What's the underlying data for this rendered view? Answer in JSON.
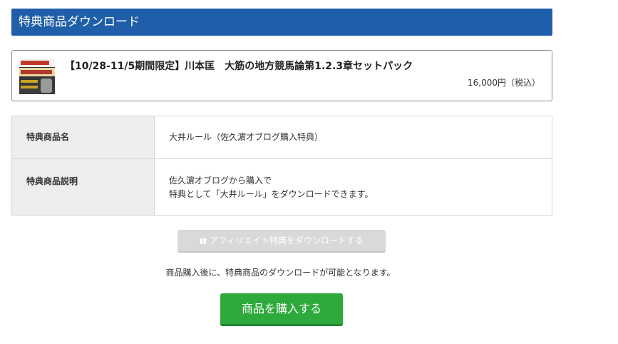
{
  "section": {
    "title": "特典商品ダウンロード"
  },
  "product": {
    "thumbnail_icon": "product-thumbnail",
    "title": "【10/28-11/5期間限定】川本匡　大筋の地方競馬論第1.2.3章セットパック",
    "price": "16,000円（税込）"
  },
  "details": {
    "rows": [
      {
        "label": "特典商品名",
        "value_lines": [
          "大井ルール（佐久濵才ブログ購入特典）"
        ]
      },
      {
        "label": "特典商品説明",
        "value_lines": [
          "佐久濵才ブログから購入で",
          "特典として「大井ルール」をダウンロードできます。"
        ]
      }
    ]
  },
  "affiliate_button": {
    "icon": "gift-icon",
    "label": "アフィリエイト特典をダウンロードする"
  },
  "notice": "商品購入後に、特典商品のダウンロードが可能となります。",
  "buy_button": {
    "label": "商品を購入する"
  },
  "colors": {
    "header_bg": "#1f5ea8",
    "buy_button": "#2eaa3c",
    "disabled_button": "#d9d9d9"
  }
}
